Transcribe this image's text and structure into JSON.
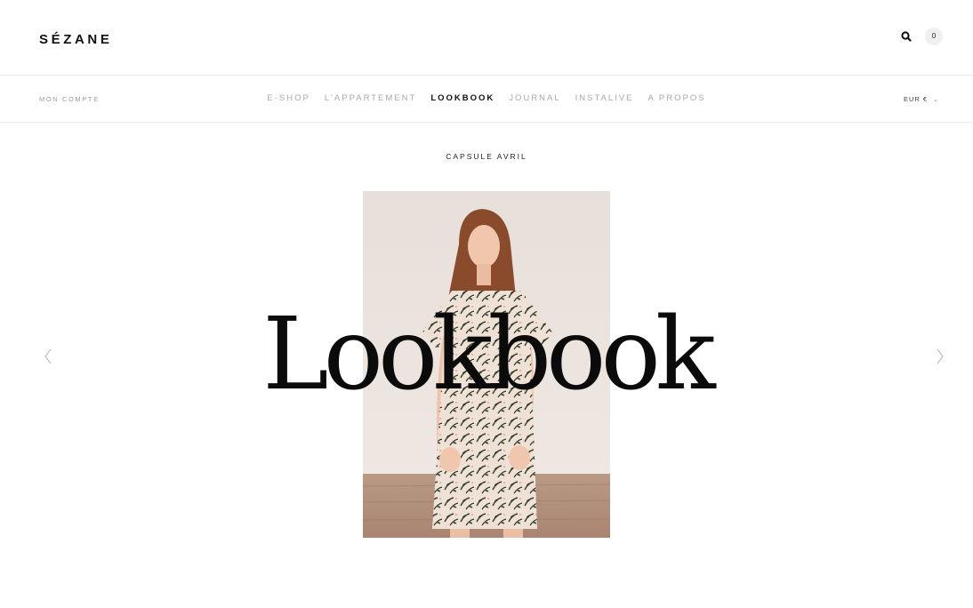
{
  "brand": {
    "logo": "SÉZANE"
  },
  "header": {
    "search_icon": "search-icon",
    "cart_count": "0"
  },
  "navbar": {
    "account": "MON COMPTE",
    "items": [
      {
        "label": "E-SHOP",
        "active": false
      },
      {
        "label": "L'APPARTEMENT",
        "active": false
      },
      {
        "label": "LOOKBOOK",
        "active": true
      },
      {
        "label": "JOURNAL",
        "active": false
      },
      {
        "label": "INSTALIVE",
        "active": false
      },
      {
        "label": "A PROPOS",
        "active": false
      }
    ],
    "currency": "EUR €"
  },
  "main": {
    "subtitle": "CAPSULE AVRIL",
    "hero_title": "Lookbook",
    "photo_icon": "model-floral-dress-photo",
    "prev_icon": "chevron-left-icon",
    "next_icon": "chevron-right-icon"
  },
  "colors": {
    "text": "#111111",
    "muted": "#a8a8a8",
    "divider": "#ececec",
    "background": "#ffffff"
  }
}
